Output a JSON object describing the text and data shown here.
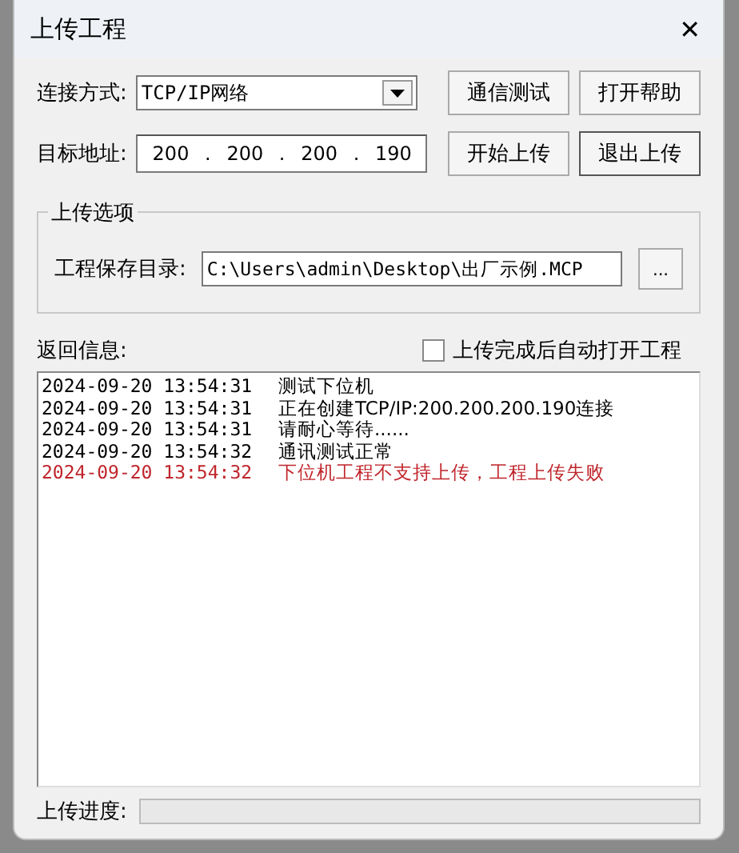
{
  "window": {
    "title": "上传工程",
    "close": "✕"
  },
  "connection": {
    "label": "连接方式:",
    "value": "TCP/IP网络"
  },
  "address": {
    "label": "目标地址:",
    "octets": [
      "200",
      "200",
      "200",
      "190"
    ],
    "separator": "."
  },
  "buttons": [
    {
      "label": "通信测试"
    },
    {
      "label": "打开帮助"
    },
    {
      "label": "开始上传"
    },
    {
      "label": "退出上传"
    }
  ],
  "upload_options": {
    "title": "上传选项",
    "label": "工程保存目录:",
    "path": "C:\\Users\\admin\\Desktop\\出厂示例.MCP",
    "browse": "..."
  },
  "log_label": "返回信息:",
  "auto_open": {
    "label": "上传完成后自动打开工程",
    "checked": false
  },
  "log": [
    {
      "time": "2024-09-20 13:54:31",
      "message": "测试下位机",
      "kind": "info"
    },
    {
      "time": "2024-09-20 13:54:31",
      "message": "正在创建TCP/IP:200.200.200.190连接",
      "kind": "info"
    },
    {
      "time": "2024-09-20 13:54:31",
      "message": "请耐心等待......",
      "kind": "info"
    },
    {
      "time": "2024-09-20 13:54:32",
      "message": "通讯测试正常",
      "kind": "info"
    },
    {
      "time": "2024-09-20 13:54:32",
      "message": "下位机工程不支持上传，工程上传失败",
      "kind": "error"
    }
  ],
  "progress": {
    "label": "上传进度:",
    "level": 0
  }
}
